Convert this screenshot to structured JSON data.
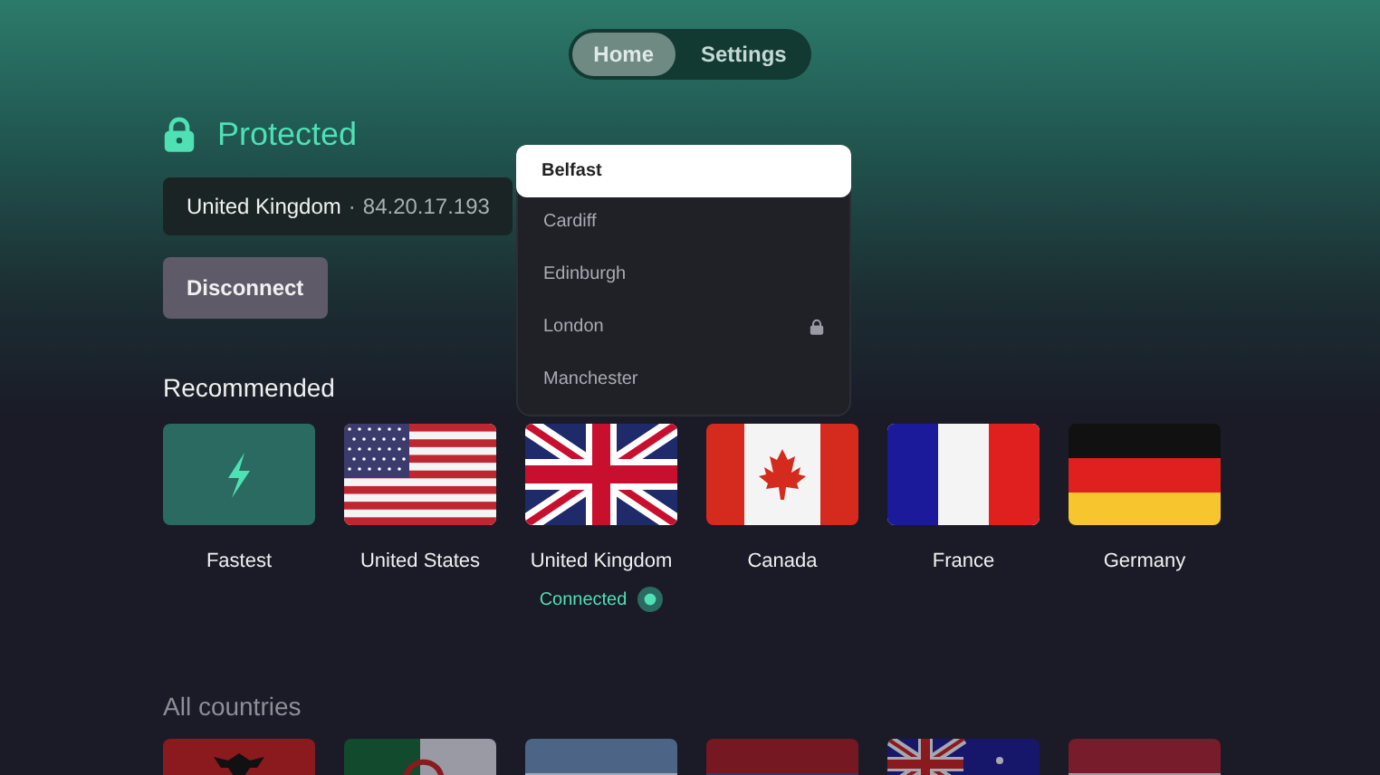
{
  "tabs": [
    {
      "label": "Home",
      "selected": true
    },
    {
      "label": "Settings",
      "selected": false
    }
  ],
  "status": {
    "label": "Protected"
  },
  "connection": {
    "country": "United Kingdom",
    "separator": "·",
    "ip": "84.20.17.193"
  },
  "disconnect_button": "Disconnect",
  "city_dropdown": {
    "items": [
      {
        "label": "Belfast",
        "selected": true,
        "locked": false
      },
      {
        "label": "Cardiff",
        "selected": false,
        "locked": false
      },
      {
        "label": "Edinburgh",
        "selected": false,
        "locked": false
      },
      {
        "label": "London",
        "selected": false,
        "locked": true
      },
      {
        "label": "Manchester",
        "selected": false,
        "locked": false
      }
    ]
  },
  "recommended": {
    "title": "Recommended",
    "items": [
      {
        "kind": "fastest",
        "label": "Fastest",
        "connected": false
      },
      {
        "kind": "us",
        "label": "United States",
        "connected": false
      },
      {
        "kind": "uk",
        "label": "United Kingdom",
        "connected": true,
        "status": "Connected"
      },
      {
        "kind": "ca",
        "label": "Canada",
        "connected": false
      },
      {
        "kind": "fr",
        "label": "France",
        "connected": false
      },
      {
        "kind": "de",
        "label": "Germany",
        "connected": false
      }
    ]
  },
  "all_countries": {
    "title": "All countries",
    "items": [
      {
        "kind": "al"
      },
      {
        "kind": "dz"
      },
      {
        "kind": "ar"
      },
      {
        "kind": "am"
      },
      {
        "kind": "au"
      },
      {
        "kind": "at"
      }
    ]
  }
}
